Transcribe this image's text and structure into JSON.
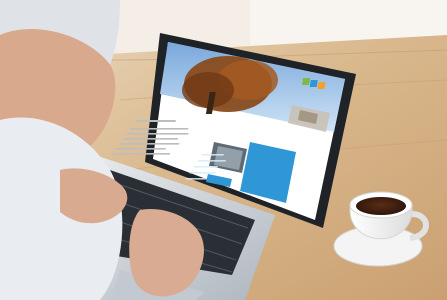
{
  "scene": {
    "subject": "person-using-laptop",
    "colors": {
      "background": "#f3ece2",
      "table_wood": "#d7b88f",
      "laptop_body": "#c9ced4",
      "screen_frame": "#1f2328",
      "site_header_sky": "#9fc2e6",
      "site_sidebar": "#2f97d6",
      "cup": "#f7f7f7",
      "coffee": "#3b1e12",
      "skin": "#e2b59a",
      "shirt": "#e9edf2"
    }
  }
}
